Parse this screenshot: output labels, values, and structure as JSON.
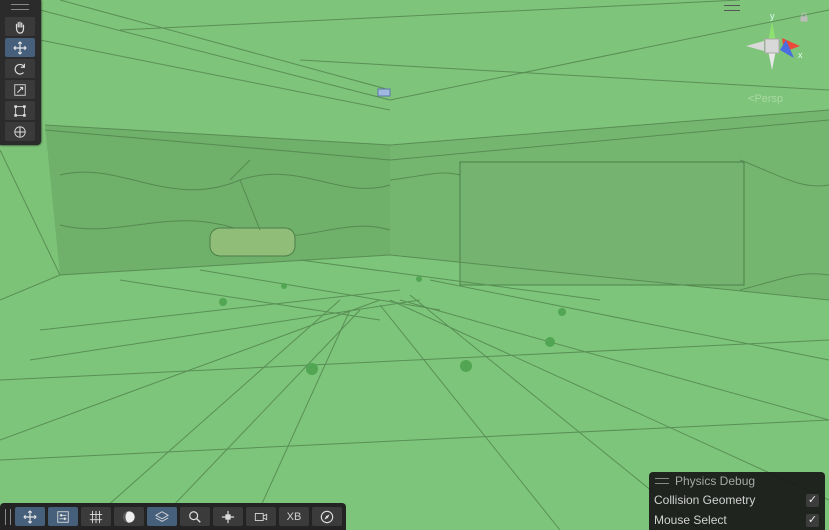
{
  "tools": [
    {
      "icon": "hand-icon"
    },
    {
      "icon": "move-icon",
      "active": true
    },
    {
      "icon": "rotate-icon"
    },
    {
      "icon": "scale-icon"
    },
    {
      "icon": "rect-transform-icon"
    },
    {
      "icon": "transform-icon"
    }
  ],
  "gizmo": {
    "y_label": "y",
    "x_label": "x",
    "projection_label": "Persp"
  },
  "bottom_toolbar": {
    "xb_label": "XB",
    "buttons": [
      "move-icon",
      "settings-sliders-icon",
      "grid-icon",
      "sphere-icon",
      "layers-icon",
      "search-icon",
      "snap-icon",
      "camera-icon",
      "xb-button",
      "compass-icon"
    ]
  },
  "physics_debug": {
    "title": "Physics Debug",
    "rows": [
      {
        "label": "Collision Geometry",
        "checked": true,
        "mark": "✓"
      },
      {
        "label": "Mouse Select",
        "checked": true,
        "mark": "✓"
      }
    ]
  },
  "colors": {
    "scene_green": "#7cc277",
    "toolbar_bg": "#2b2b2b",
    "active_tool": "#46607c",
    "wire": "#4e7e4a"
  }
}
